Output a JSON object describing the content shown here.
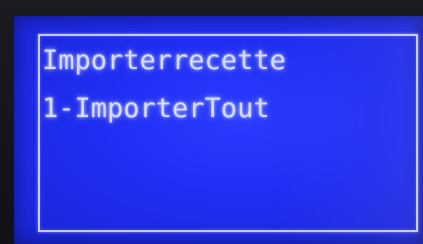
{
  "display": {
    "line1": "Importerrecette",
    "line2": "1-ImporterTout"
  },
  "colors": {
    "screen_background": "#1f2ef2",
    "text": "#d7dcff",
    "frame": "#e1e8ff"
  }
}
